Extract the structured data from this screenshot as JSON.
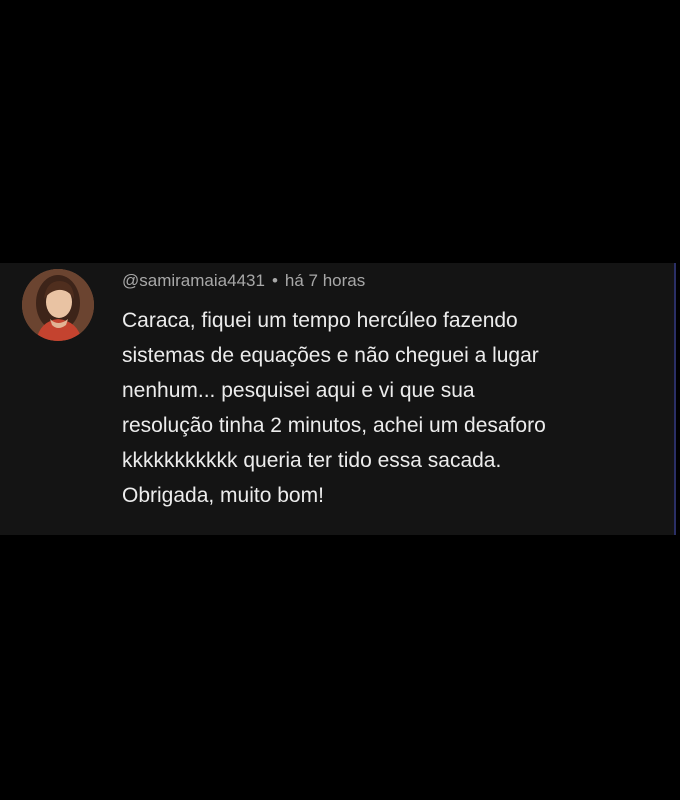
{
  "comment": {
    "author": "@samiramaia4431",
    "separator": "•",
    "time": "há 7 horas",
    "text": "Caraca, fiquei um tempo hercúleo fazendo\nsistemas de equações e não cheguei a lugar\nnenhum... pesquisei aqui e vi que sua\nresolução tinha 2 minutos, achei um desaforo\nkkkkkkkkkkk queria ter tido essa sacada.\nObrigada, muito bom!",
    "avatar_icon": "user-photo-avatar"
  },
  "colors": {
    "page_background": "#000000",
    "card_background": "#141414",
    "meta_text": "#a8a8a8",
    "body_text": "#ececec"
  }
}
